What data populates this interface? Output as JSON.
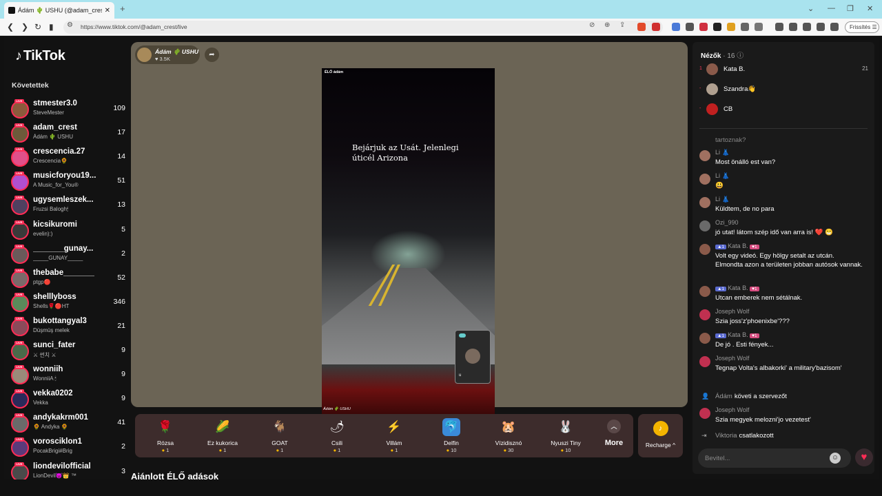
{
  "browser": {
    "tab_title": "Ádám 🌵 USHU (@adam_crest",
    "url": "https://www.tiktok.com/@adam_crest/live",
    "refresh_label": "Frissítés"
  },
  "sidebar": {
    "logo": "TikTok",
    "following_title": "Követettek",
    "accounts": [
      {
        "user": "stmester3.0",
        "nick": "SteveMester",
        "count": "109",
        "color": "#8b5a3c"
      },
      {
        "user": "adam_crest",
        "nick": "Ádám 🌵 USHU",
        "count": "17",
        "color": "#6d5a3a"
      },
      {
        "user": "crescencia.27",
        "nick": "Crescencia🌻",
        "count": "14",
        "color": "#e0508a"
      },
      {
        "user": "musicforyou19...",
        "nick": "A Music_for_You®",
        "count": "51",
        "color": "#b050d0"
      },
      {
        "user": "ugysemleszek...",
        "nick": "Fruzsi Balogh🕯",
        "count": "13",
        "color": "#504060"
      },
      {
        "user": "kicsikuromi",
        "nick": "evelin):)",
        "count": "5",
        "color": "#3a3a3a"
      },
      {
        "user": "_______gunay...",
        "nick": "_____GUNAY_____",
        "count": "2",
        "color": "#6a5a5a"
      },
      {
        "user": "thebabe_______",
        "nick": "ptgp🔴",
        "count": "52",
        "color": "#7a6a6a"
      },
      {
        "user": "shelllyboss",
        "nick": "Shells🌹🔴HT",
        "count": "346",
        "color": "#5a8a5a"
      },
      {
        "user": "bukottangyal3",
        "nick": "Düşmüş melek",
        "count": "21",
        "color": "#8a4a5a"
      },
      {
        "user": "sunci_fater",
        "nick": "⚔ 썬치 ⚔",
        "count": "9",
        "color": "#4a6a4a"
      },
      {
        "user": "wonniih",
        "nick": "WonniiA 🕯",
        "count": "9",
        "color": "#9a8a7a"
      },
      {
        "user": "vekka0202",
        "nick": "Vekka",
        "count": "9",
        "color": "#2a2a5a"
      },
      {
        "user": "andykakrm001",
        "nick": "🌻 Andyka 🌻",
        "count": "41",
        "color": "#6a6a6a"
      },
      {
        "user": "vorosciklon1",
        "nick": "PocakBrigi#Brig",
        "count": "2",
        "color": "#5a3a7a"
      },
      {
        "user": "liondevilofficial",
        "nick": "LionDevil😈👑 ™",
        "count": "3",
        "color": "#4a4a4a"
      }
    ]
  },
  "stage": {
    "host_name": "Ádám 🌵 USHU",
    "host_likes": "♥ 3.5K",
    "video_tag": "ÉLŐ ádám",
    "caption": "Bejárjuk az Usát. Jelenlegi úticél Arizona",
    "video_footer": "Ádám 🌵 USHU",
    "guest_label": "u"
  },
  "gifts": [
    {
      "name": "Rózsa",
      "price": "1",
      "icon": "🌹",
      "bg": "transparent"
    },
    {
      "name": "Ez kukorica",
      "price": "1",
      "icon": "🌽",
      "bg": "transparent"
    },
    {
      "name": "GOAT",
      "price": "1",
      "icon": "🐐",
      "bg": "transparent"
    },
    {
      "name": "Csili",
      "price": "1",
      "icon": "🌶",
      "bg": "transparent"
    },
    {
      "name": "Villám",
      "price": "1",
      "icon": "⚡",
      "bg": "transparent"
    },
    {
      "name": "Delfin",
      "price": "10",
      "icon": "🐬",
      "bg": "#3a8ad8"
    },
    {
      "name": "Vízidisznó",
      "price": "30",
      "icon": "🐹",
      "bg": "transparent"
    },
    {
      "name": "Nyuszi Tiny",
      "price": "10",
      "icon": "🐰",
      "bg": "transparent"
    }
  ],
  "gift_more": "More",
  "recharge": "Recharge ^",
  "recommended": "Ajánlott ÉLŐ adások",
  "chat": {
    "viewers_label": "Nézők",
    "viewers_count": "· 16 ⓘ",
    "top_viewers": [
      {
        "rank": "1",
        "name": "Kata B.",
        "count": "21",
        "color": "#8a5a4a"
      },
      {
        "rank": "-",
        "name": "Szandra👋",
        "count": "",
        "color": "#b0a090"
      },
      {
        "rank": "-",
        "name": "CB",
        "count": "",
        "color": "#c02020"
      }
    ],
    "faded": "tartoznak?",
    "messages": [
      {
        "name": "Li 👗",
        "text": "Most önálló est van?",
        "color": "#a07060"
      },
      {
        "name": "Li 👗",
        "text": "😃",
        "color": "#a07060"
      },
      {
        "name": "Li 👗",
        "text": "Küldtem, de no para",
        "color": "#a07060"
      },
      {
        "name": "Ozi_990",
        "text": "jó utat! látom szép idő van arra is! ❤️ 😁",
        "color": "#6a6a6a"
      },
      {
        "name": "Kata B.",
        "text": "Volt egy videó. Egy hölgy setalt az utcán. Elmondta azon a területen jobban autósok vannak.",
        "color": "#8a5a4a",
        "badge": true
      },
      {
        "name": "Kata B.",
        "text": "Utcan emberek nem sétálnak.",
        "color": "#8a5a4a",
        "badge": true
      },
      {
        "name": "Joseph Wolf",
        "text": "Szia joss'z'phoenixbe'???",
        "color": "#c03050"
      },
      {
        "name": "Kata B.",
        "text": "De jó . Esti fények...",
        "color": "#8a5a4a",
        "badge": true
      },
      {
        "name": "Joseph Wolf",
        "text": "Tegnap Volta's albakorki' a military'bazisom'",
        "color": "#c03050"
      }
    ],
    "system1": {
      "name": "Ádám",
      "action": "követi a szervezőt"
    },
    "message_last": {
      "name": "Joseph Wolf",
      "text": "Szia megyek melozni'jo vezetest'",
      "color": "#c03050"
    },
    "system2": {
      "name": "Viktoria",
      "action": "csatlakozott"
    },
    "input_placeholder": "Bevitel..."
  }
}
